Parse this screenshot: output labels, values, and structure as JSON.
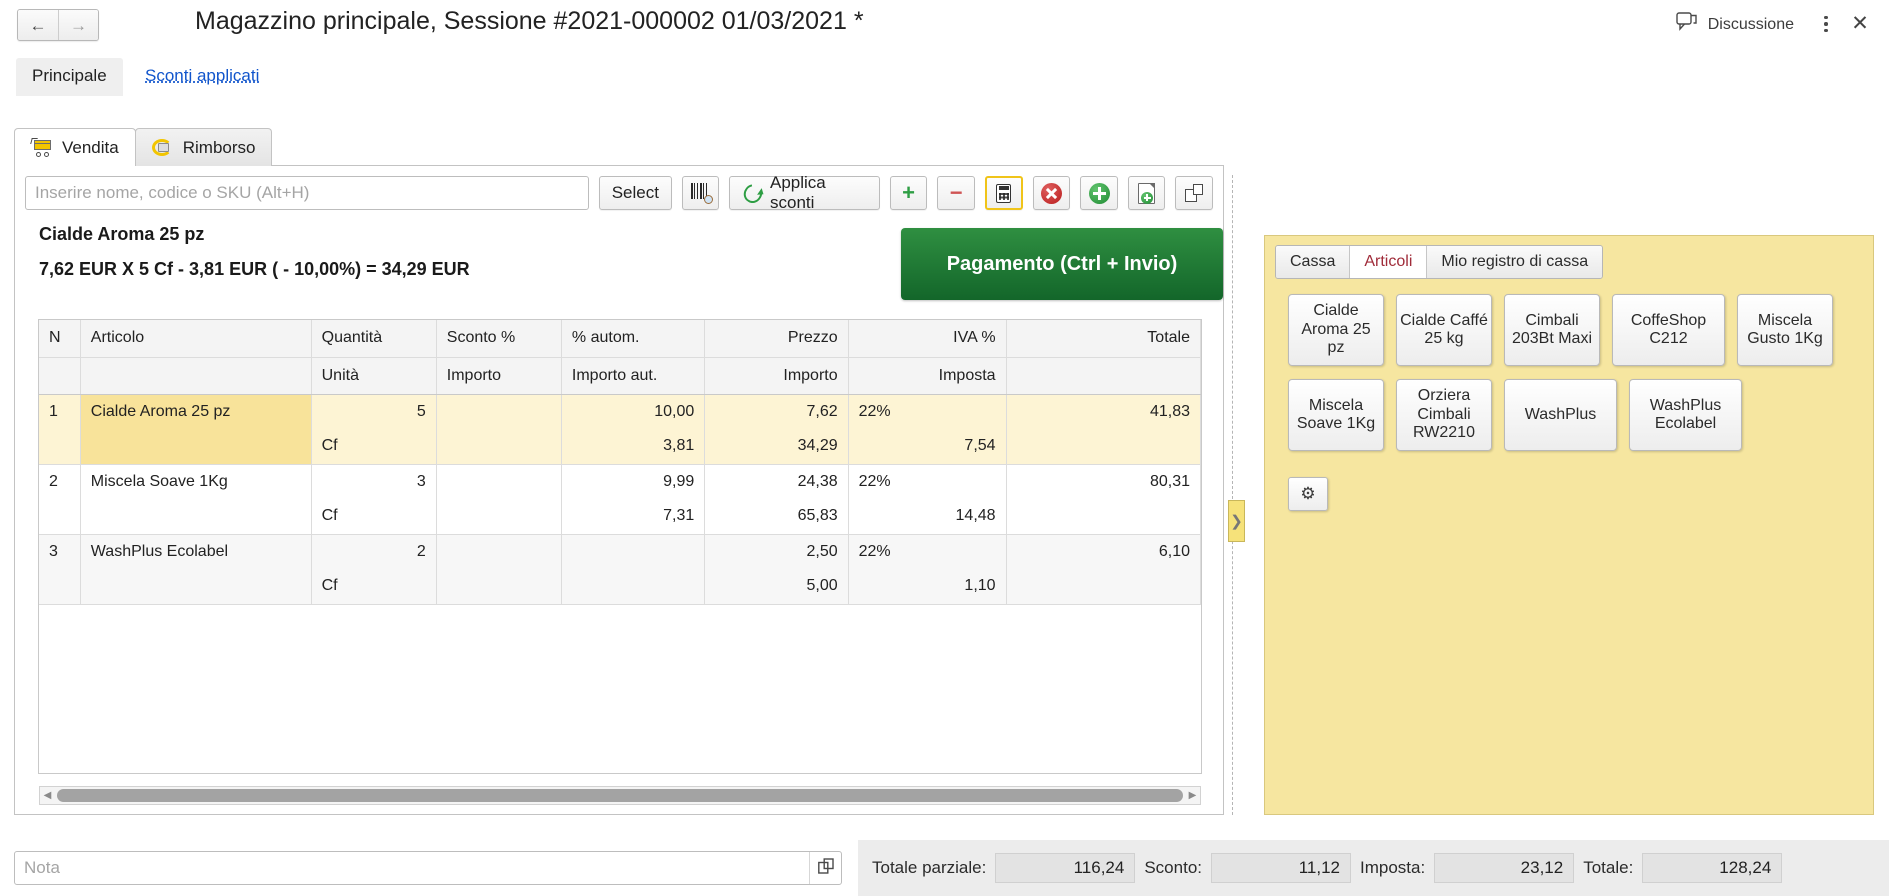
{
  "titlebar": {
    "back_icon": "arrow-left-icon",
    "forward_icon": "arrow-right-icon",
    "title": "Magazzino principale, Sessione #2021-000002 01/03/2021 *",
    "discussion_label": "Discussione",
    "discussion_icon": "chat-bubble-icon",
    "menu_icon": "kebab-menu-icon",
    "close_icon": "close-icon"
  },
  "toptabs": {
    "active": "Principale",
    "link": "Sconti applicati"
  },
  "subtabs": [
    {
      "label": "Vendita",
      "icon": "shopping-cart-icon",
      "active": true
    },
    {
      "label": "Rimborso",
      "icon": "refund-cart-icon",
      "active": false
    }
  ],
  "toolbar": {
    "search_placeholder": "Inserire nome, codice o SKU (Alt+H)",
    "search_value": "",
    "select_label": "Select",
    "barcode_icon": "barcode-scanner-icon",
    "apply_discounts_label": "Applica sconti",
    "apply_discounts_icon": "refresh-icon",
    "add_label": "+",
    "remove_label": "−",
    "calculator_icon": "calculator-icon",
    "delete_icon": "delete-circle-icon",
    "add_circle_icon": "add-circle-icon",
    "new_document_icon": "new-document-icon",
    "duplicate_icon": "duplicate-icon"
  },
  "selected_product": {
    "name": "Cialde Aroma 25 pz",
    "calculation": "7,62 EUR X 5 Cf - 3,81 EUR ( - 10,00%) = 34,29 EUR"
  },
  "payment_button": {
    "label": "Pagamento (Ctrl + Invio)",
    "color": "#1f7a33"
  },
  "grid": {
    "headers_row1": [
      "N",
      "Articolo",
      "Quantità",
      "Sconto %",
      "% autom.",
      "Prezzo",
      "IVA %",
      "Totale"
    ],
    "headers_row2": [
      "",
      "",
      "Unità",
      "Importo",
      "Importo aut.",
      "Importo",
      "Imposta",
      ""
    ],
    "rows": [
      {
        "n": "1",
        "article": "Cialde Aroma 25 pz",
        "quantity": "5",
        "discount_pct": "",
        "auto_pct": "10,00",
        "price": "7,62",
        "vat_pct": "22%",
        "total": "41,83",
        "unit": "Cf",
        "discount_amount": "",
        "auto_amount": "3,81",
        "amount": "34,29",
        "tax": "7,54",
        "selected": true
      },
      {
        "n": "2",
        "article": "Miscela Soave 1Kg",
        "quantity": "3",
        "discount_pct": "",
        "auto_pct": "9,99",
        "price": "24,38",
        "vat_pct": "22%",
        "total": "80,31",
        "unit": "Cf",
        "discount_amount": "",
        "auto_amount": "7,31",
        "amount": "65,83",
        "tax": "14,48",
        "selected": false
      },
      {
        "n": "3",
        "article": "WashPlus Ecolabel",
        "quantity": "2",
        "discount_pct": "",
        "auto_pct": "",
        "price": "2,50",
        "vat_pct": "22%",
        "total": "6,10",
        "unit": "Cf",
        "discount_amount": "",
        "auto_amount": "",
        "amount": "5,00",
        "tax": "1,10",
        "selected": false
      }
    ],
    "hscroll_left_icon": "scroll-left-arrow",
    "hscroll_right_icon": "scroll-right-arrow"
  },
  "splitter": {
    "icon": "chevron-right-icon"
  },
  "right_panel": {
    "background": "#f6e6a0",
    "tabs": [
      {
        "label": "Cassa",
        "active": false
      },
      {
        "label": "Articoli",
        "active": true
      },
      {
        "label": "Mio registro di cassa",
        "active": false
      }
    ],
    "active_tab_color": "#a02c3a",
    "products": [
      {
        "label": "Cialde Aroma 25 pz",
        "wide": false
      },
      {
        "label": "Cialde Caffé 25 kg",
        "wide": false
      },
      {
        "label": "Cimbali 203Bt Maxi",
        "wide": false
      },
      {
        "label": "CoffeShop C212",
        "wide": true
      },
      {
        "label": "Miscela Gusto 1Kg",
        "wide": false
      },
      {
        "label": "Miscela Soave 1Kg",
        "wide": false
      },
      {
        "label": "Orziera Cimbali RW2210",
        "wide": false
      },
      {
        "label": "WashPlus",
        "wide": true
      },
      {
        "label": "WashPlus Ecolabel",
        "wide": true
      }
    ],
    "settings_icon": "gear-icon"
  },
  "bottom": {
    "note_placeholder": "Nota",
    "note_value": "",
    "note_expand_icon": "expand-icon",
    "totals": [
      {
        "label": "Totale parziale:",
        "value": "116,24"
      },
      {
        "label": "Sconto:",
        "value": "11,12"
      },
      {
        "label": "Imposta:",
        "value": "23,12"
      },
      {
        "label": "Totale:",
        "value": "128,24"
      }
    ]
  }
}
